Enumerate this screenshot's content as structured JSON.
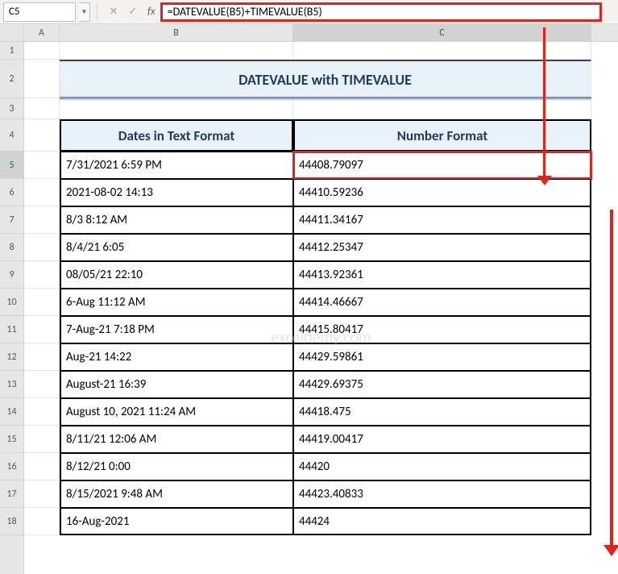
{
  "formula_bar": {
    "cell_ref": "C5",
    "formula": "=DATEVALUE(B5)+TIMEVALUE(B5)",
    "fx_label": "fx"
  },
  "columns": [
    "A",
    "B",
    "C"
  ],
  "row_numbers": [
    "1",
    "2",
    "3",
    "4",
    "5",
    "6",
    "7",
    "8",
    "9",
    "10",
    "11",
    "12",
    "13",
    "14",
    "15",
    "16",
    "17",
    "18"
  ],
  "title": "DATEVALUE with TIMEVALUE",
  "headers": {
    "b": "Dates in Text Format",
    "c": "Number Format"
  },
  "rows": [
    {
      "b": "7/31/2021 6:59 PM",
      "c": "44408.79097"
    },
    {
      "b": "2021-08-02 14:13",
      "c": "44410.59236"
    },
    {
      "b": "8/3 8:12 AM",
      "c": "44411.34167"
    },
    {
      "b": "8/4/21 6:05",
      "c": "44412.25347"
    },
    {
      "b": "08/05/21 22:10",
      "c": "44413.92361"
    },
    {
      "b": "6-Aug 11:12 AM",
      "c": "44414.46667"
    },
    {
      "b": "7-Aug-21 7:18 PM",
      "c": "44415.80417"
    },
    {
      "b": "Aug-21 14:22",
      "c": "44429.59861"
    },
    {
      "b": "August-21 16:39",
      "c": "44429.69375"
    },
    {
      "b": "August 10, 2021 11:24 AM",
      "c": "44418.475"
    },
    {
      "b": "8/11/21 12:06 AM",
      "c": "44419.00417"
    },
    {
      "b": "8/12/21 0:00",
      "c": "44420"
    },
    {
      "b": "8/15/2021 9:48 AM",
      "c": "44423.40833"
    },
    {
      "b": "16-Aug-2021",
      "c": "44424"
    }
  ],
  "watermark": "exceldemy.com"
}
